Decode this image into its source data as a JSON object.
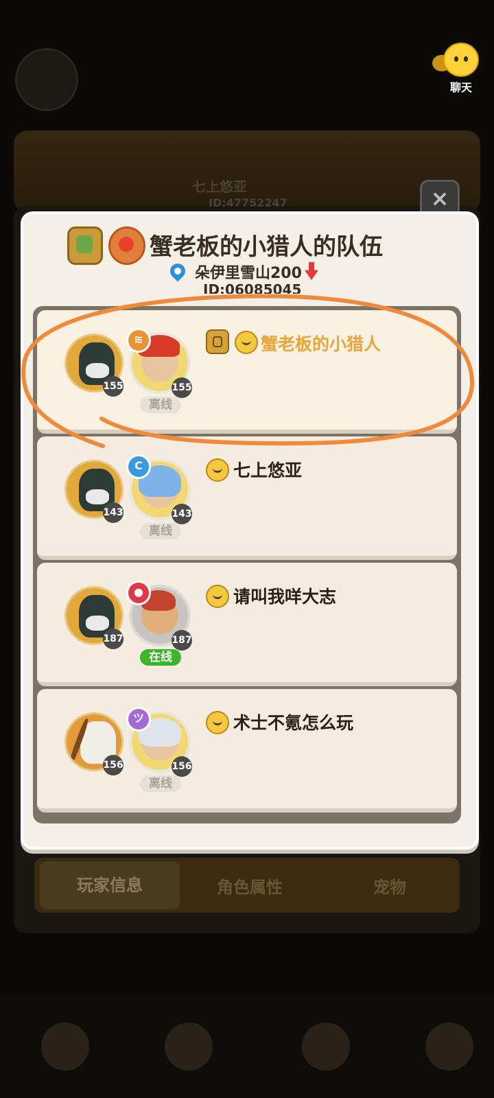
{
  "chat": {
    "label": "聊天",
    "icon": "chat-bubble-icon"
  },
  "background": {
    "owner_name": "七上悠亚",
    "owner_id": "ID:47752247",
    "tabs": [
      {
        "label": "玩家信息",
        "active": true
      },
      {
        "label": "角色属性",
        "active": false
      },
      {
        "label": "宠物",
        "active": false
      }
    ]
  },
  "close_button": {
    "label": "×"
  },
  "team": {
    "name": "蟹老板的小猎人的队伍",
    "location": "朵伊里雪山200",
    "id": "ID:06085045"
  },
  "members": [
    {
      "name": "蟹老板的小猎人",
      "is_self": true,
      "avatar_level": "155",
      "pet_level": "155",
      "status": "离线",
      "online": false,
      "element": "fire",
      "element_glyph": "≋"
    },
    {
      "name": "七上悠亚",
      "is_self": false,
      "avatar_level": "143",
      "pet_level": "143",
      "status": "离线",
      "online": false,
      "element": "water",
      "element_glyph": "C"
    },
    {
      "name": "请叫我咩大志",
      "is_self": false,
      "avatar_level": "187",
      "pet_level": "187",
      "status": "在线",
      "online": true,
      "element": "red",
      "element_glyph": "●"
    },
    {
      "name": "术士不氪怎么玩",
      "is_self": false,
      "avatar_level": "156",
      "pet_level": "156",
      "status": "离线",
      "online": false,
      "element": "psychic",
      "element_glyph": "ツ"
    }
  ],
  "colors": {
    "self_name": "#e8a63a",
    "online_badge": "#3eb42a",
    "annotation": "#f08a3a"
  }
}
